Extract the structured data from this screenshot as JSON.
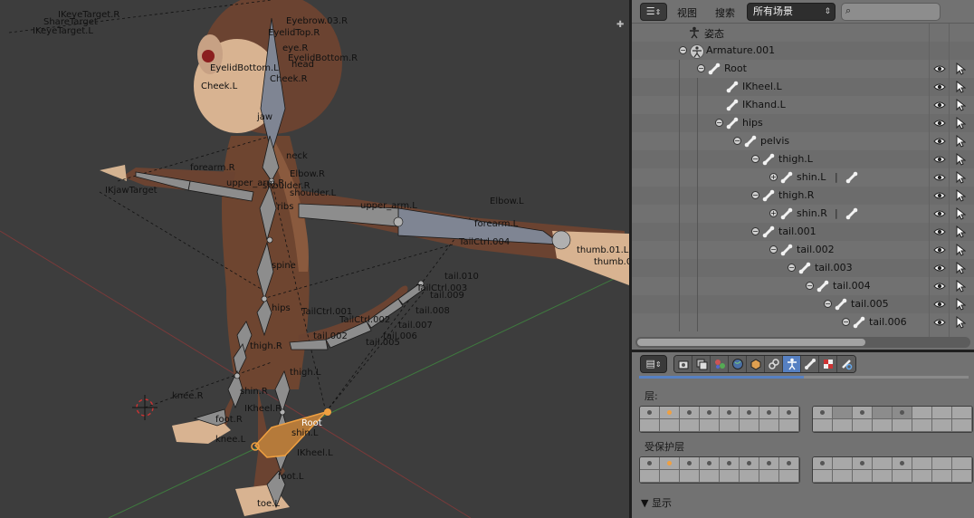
{
  "viewport": {
    "bone_labels": [
      {
        "text": "IKeyeTarget.R"
      },
      {
        "text": "ShareTarget"
      },
      {
        "text": "IKeyeTarget.L"
      },
      {
        "text": "Eyebrow.03.R"
      },
      {
        "text": "EyelidTop.R"
      },
      {
        "text": "eye.R"
      },
      {
        "text": "EyelidBottom.R"
      },
      {
        "text": "EyelidBottom.L"
      },
      {
        "text": "head"
      },
      {
        "text": "Cheek.R"
      },
      {
        "text": "Cheek.L"
      },
      {
        "text": "jaw"
      },
      {
        "text": "neck"
      },
      {
        "text": "Elbow.R"
      },
      {
        "text": "upper_arm.R"
      },
      {
        "text": "shoulder.R"
      },
      {
        "text": "shoulder.L"
      },
      {
        "text": "ribs"
      },
      {
        "text": "IKjawTarget"
      },
      {
        "text": "forearm.R"
      },
      {
        "text": "Elbow.L"
      },
      {
        "text": "upper_arm.L"
      },
      {
        "text": "forearm.L"
      },
      {
        "text": "TailCtrl.004"
      },
      {
        "text": "thumb.01.L"
      },
      {
        "text": "thumb.0"
      },
      {
        "text": "spine"
      },
      {
        "text": "tail.010"
      },
      {
        "text": "TailCtrl.003"
      },
      {
        "text": "tail.009"
      },
      {
        "text": "tail.008"
      },
      {
        "text": "hips"
      },
      {
        "text": "TailCtrl.001"
      },
      {
        "text": "TailCtrl.002"
      },
      {
        "text": "tail.007"
      },
      {
        "text": "tail.006"
      },
      {
        "text": "tail.002"
      },
      {
        "text": "tail.005"
      },
      {
        "text": "thigh.R"
      },
      {
        "text": "thigh.L"
      },
      {
        "text": "knee.R"
      },
      {
        "text": "shin.R"
      },
      {
        "text": "IKheel.R"
      },
      {
        "text": "foot.R"
      },
      {
        "text": "Root"
      },
      {
        "text": "shin.L"
      },
      {
        "text": "knee.L"
      },
      {
        "text": "IKheel.L"
      },
      {
        "text": "foot.L"
      },
      {
        "text": "toe.L"
      }
    ]
  },
  "outliner": {
    "editor_type_icon": "outliner-icon",
    "menu_view": "视图",
    "menu_search": "搜索",
    "scene_select": "所有场景",
    "search_placeholder": "",
    "rows": [
      {
        "label": "姿态",
        "icon": "pose-icon"
      },
      {
        "label": "Armature.001",
        "icon": "armature-icon"
      },
      {
        "label": "Root",
        "icon": "bone-icon"
      },
      {
        "label": "IKheel.L",
        "icon": "bone-icon"
      },
      {
        "label": "IKhand.L",
        "icon": "bone-icon"
      },
      {
        "label": "hips",
        "icon": "bone-icon"
      },
      {
        "label": "pelvis",
        "icon": "bone-icon"
      },
      {
        "label": "thigh.L",
        "icon": "bone-icon"
      },
      {
        "label": "shin.L",
        "icon": "bone-icon"
      },
      {
        "label": "thigh.R",
        "icon": "bone-icon"
      },
      {
        "label": "shin.R",
        "icon": "bone-icon"
      },
      {
        "label": "tail.001",
        "icon": "bone-icon"
      },
      {
        "label": "tail.002",
        "icon": "bone-icon"
      },
      {
        "label": "tail.003",
        "icon": "bone-icon"
      },
      {
        "label": "tail.004",
        "icon": "bone-icon"
      },
      {
        "label": "tail.005",
        "icon": "bone-icon"
      },
      {
        "label": "tail.006",
        "icon": "bone-icon"
      }
    ]
  },
  "properties": {
    "tabs": [
      {
        "icon": "render-icon"
      },
      {
        "icon": "render-layers-icon"
      },
      {
        "icon": "scene-icon"
      },
      {
        "icon": "world-icon"
      },
      {
        "icon": "object-icon"
      },
      {
        "icon": "constraints-icon"
      },
      {
        "icon": "armature-data-icon",
        "active": true
      },
      {
        "icon": "bone-icon"
      },
      {
        "icon": "material-icon"
      },
      {
        "icon": "bone-constraints-icon"
      }
    ],
    "tab_scroll_fraction": 0.5,
    "layers_label": "层:",
    "protected_layers_label": "受保护层",
    "display_panel_label": "显示"
  },
  "colors": {
    "active_tab": "#5680c2",
    "active_layer_dot": "#f0a040",
    "selected_bone": "#f0a040"
  }
}
